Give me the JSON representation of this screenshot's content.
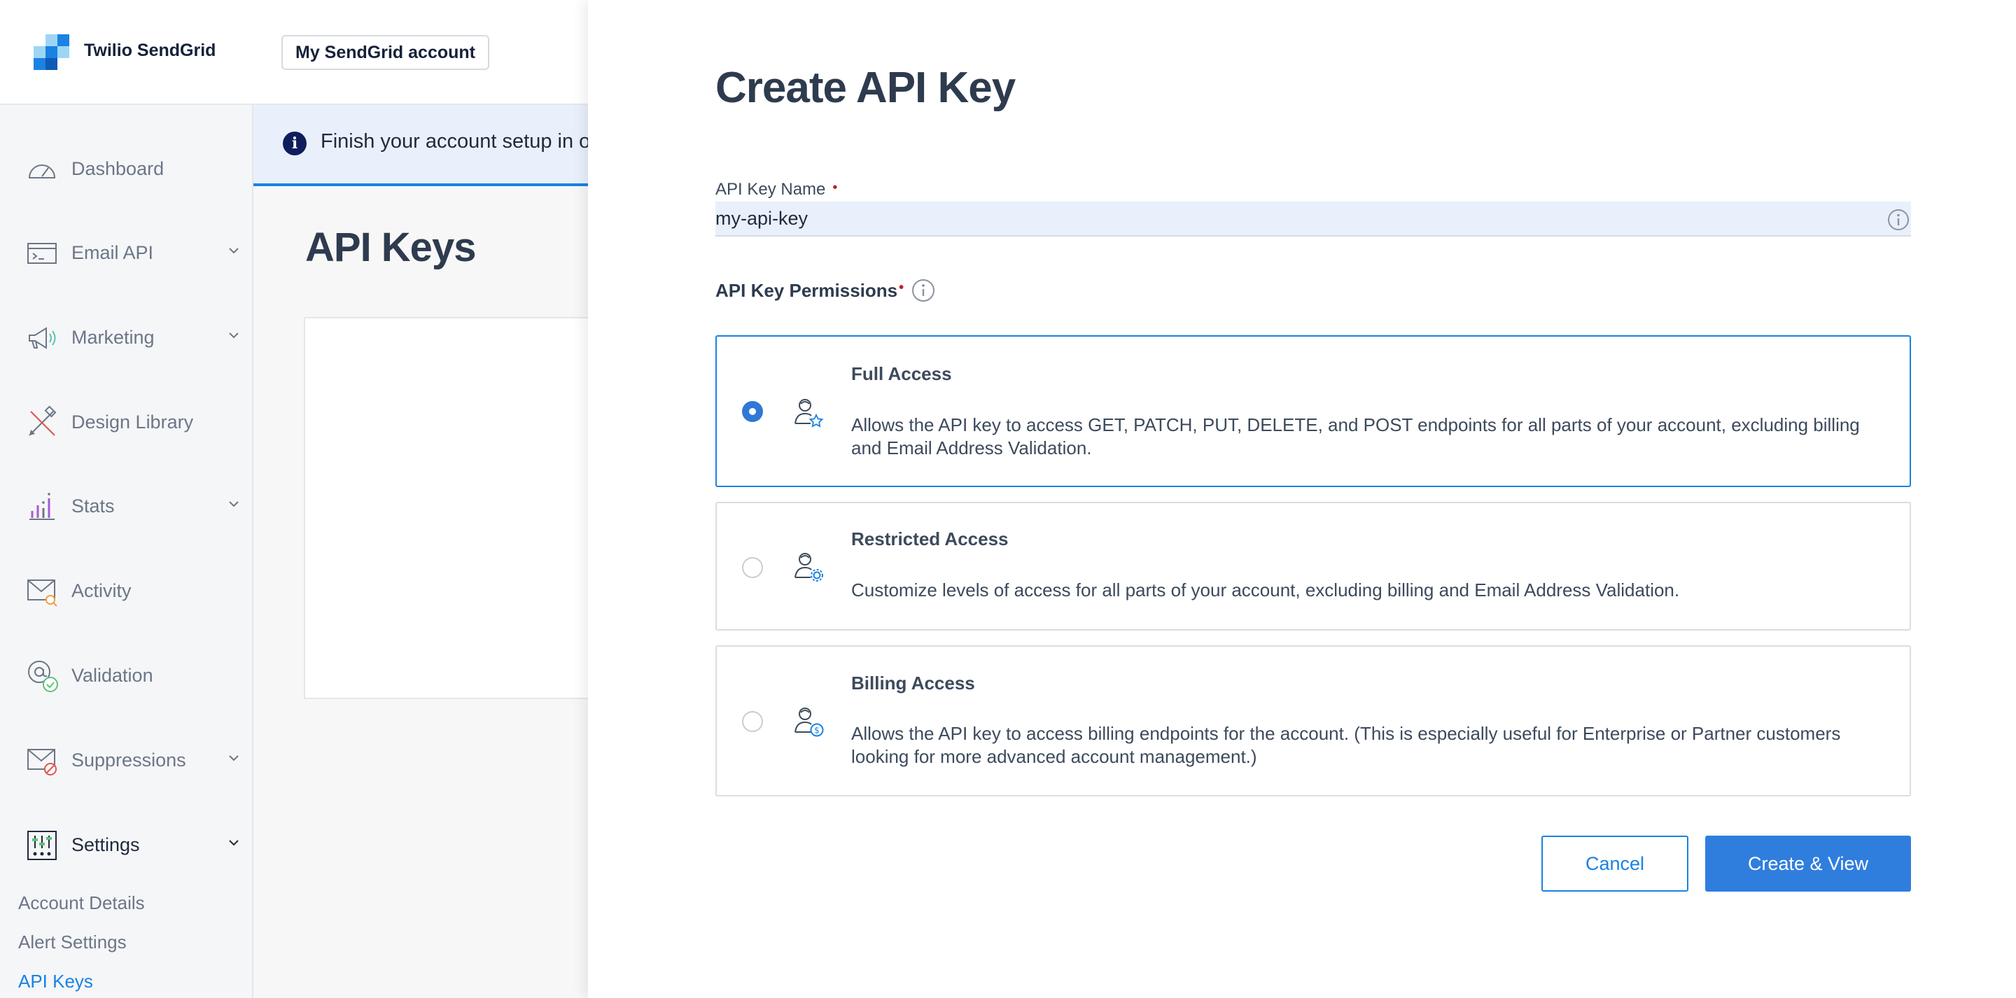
{
  "topbar": {
    "brand": "Twilio SendGrid",
    "account_button": "My SendGrid account"
  },
  "sidebar": {
    "items": [
      {
        "label": "Dashboard",
        "icon": "dashboard-gauge-icon",
        "expandable": false
      },
      {
        "label": "Email API",
        "icon": "email-api-terminal-icon",
        "expandable": true
      },
      {
        "label": "Marketing",
        "icon": "megaphone-icon",
        "expandable": true
      },
      {
        "label": "Design Library",
        "icon": "design-tools-icon",
        "expandable": false
      },
      {
        "label": "Stats",
        "icon": "bar-stats-icon",
        "expandable": true
      },
      {
        "label": "Activity",
        "icon": "activity-envelope-icon",
        "expandable": false
      },
      {
        "label": "Validation",
        "icon": "validation-at-icon",
        "expandable": false
      },
      {
        "label": "Suppressions",
        "icon": "suppressions-envelope-icon",
        "expandable": true
      },
      {
        "label": "Settings",
        "icon": "settings-sliders-icon",
        "expandable": true
      }
    ],
    "settings_subitems": [
      "Account Details",
      "Alert Settings",
      "API Keys"
    ],
    "current_subitem": "API Keys"
  },
  "main": {
    "banner_text": "Finish your account setup in o",
    "page_title": "API Keys"
  },
  "drawer": {
    "title": "Create API Key",
    "name_field": {
      "label": "API Key Name",
      "required_marker": "•",
      "value": "my-api-key"
    },
    "permissions": {
      "label": "API Key Permissions",
      "required_marker": "•",
      "selected": "Full Access",
      "options": [
        {
          "title": "Full Access",
          "description": "Allows the API key to access GET, PATCH, PUT, DELETE, and POST endpoints for all parts of your account, excluding billing and Email Address Validation.",
          "icon": "user-star-icon"
        },
        {
          "title": "Restricted Access",
          "description": "Customize levels of access for all parts of your account, excluding billing and Email Address Validation.",
          "icon": "user-gear-icon"
        },
        {
          "title": "Billing Access",
          "description": "Allows the API key to access billing endpoints for the account. (This is especially useful for Enterprise or Partner customers looking for more advanced account management.)",
          "icon": "user-dollar-icon"
        }
      ]
    },
    "buttons": {
      "cancel": "Cancel",
      "create": "Create & View"
    }
  },
  "colors": {
    "accent": "#1a82e2",
    "title_text": "#2e3b4f",
    "required": "#c0202b",
    "input_bg": "#e9f0fb"
  }
}
